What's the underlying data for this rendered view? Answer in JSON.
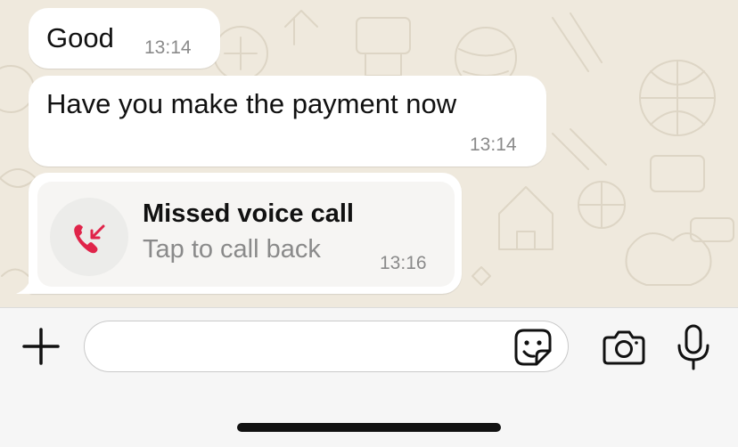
{
  "messages": [
    {
      "text": "Good",
      "time": "13:14"
    },
    {
      "text": "Have you make the payment now",
      "time": "13:14"
    }
  ],
  "missed_call": {
    "title": "Missed voice call",
    "subtitle": "Tap to call back",
    "time": "13:16",
    "icon": "missed-call-icon",
    "accent_color": "#e0244a"
  },
  "input_bar": {
    "message_value": "",
    "icons": [
      "plus-icon",
      "sticker-icon",
      "camera-icon",
      "microphone-icon"
    ]
  },
  "colors": {
    "chat_background": "#efe9dd",
    "bubble": "#ffffff",
    "timestamp": "#8a8a8a"
  }
}
